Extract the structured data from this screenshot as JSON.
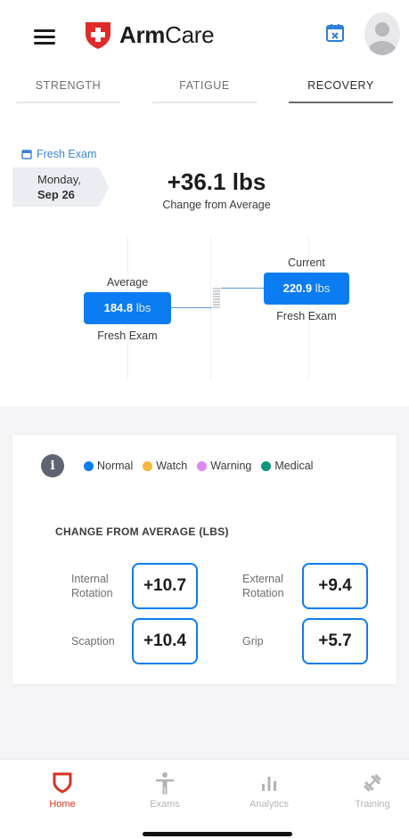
{
  "header": {
    "brand_bold": "Arm",
    "brand_light": "Care",
    "brand_color": "#e12a2a",
    "icons": [
      "hamburger-menu-icon",
      "calendar-icon",
      "user-avatar-icon"
    ]
  },
  "tabs": [
    {
      "label": "STRENGTH",
      "active": false
    },
    {
      "label": "FATIGUE",
      "active": false
    },
    {
      "label": "RECOVERY",
      "active": true
    }
  ],
  "exam": {
    "link_label": "Fresh Exam",
    "day": "Monday,",
    "date": "Sep 26",
    "delta": "+36.1 lbs",
    "delta_caption": "Change from Average"
  },
  "comparison": {
    "average": {
      "top_label": "Average",
      "value": "184.8",
      "unit": "lbs",
      "bottom_label": "Fresh Exam"
    },
    "current": {
      "top_label": "Current",
      "value": "220.9",
      "unit": "lbs",
      "bottom_label": "Fresh Exam"
    }
  },
  "legend": [
    {
      "label": "Normal",
      "color": "#0c7cf2"
    },
    {
      "label": "Watch",
      "color": "#f7b63c"
    },
    {
      "label": "Warning",
      "color": "#dd87f2"
    },
    {
      "label": "Medical",
      "color": "#10957c"
    }
  ],
  "metrics": {
    "title": "CHANGE FROM AVERAGE (LBS)",
    "items": [
      {
        "label_line1": "Internal",
        "label_line2": "Rotation",
        "value": "+10.7"
      },
      {
        "label_line1": "External",
        "label_line2": "Rotation",
        "value": "+9.4"
      },
      {
        "label_line1": "Scaption",
        "label_line2": "",
        "value": "+10.4"
      },
      {
        "label_line1": "Grip",
        "label_line2": "",
        "value": "+5.7"
      }
    ]
  },
  "bottom_nav": [
    {
      "label": "Home",
      "icon": "home-shield-icon",
      "active": true
    },
    {
      "label": "Exams",
      "icon": "person-icon",
      "active": false
    },
    {
      "label": "Analytics",
      "icon": "bar-chart-icon",
      "active": false
    },
    {
      "label": "Training",
      "icon": "dumbbell-icon",
      "active": false
    }
  ]
}
